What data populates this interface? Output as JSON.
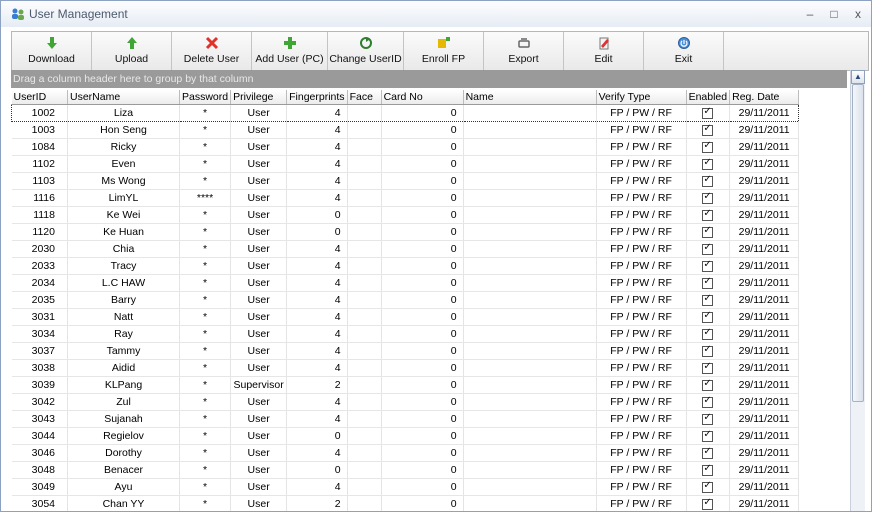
{
  "window": {
    "title": "User Management",
    "minimize": "–",
    "maximize": "□",
    "close": "x"
  },
  "toolbar": [
    {
      "label": "Download",
      "icon": "download-icon"
    },
    {
      "label": "Upload",
      "icon": "upload-icon"
    },
    {
      "label": "Delete User",
      "icon": "delete-user-icon"
    },
    {
      "label": "Add User (PC)",
      "icon": "add-user-icon"
    },
    {
      "label": "Change UserID",
      "icon": "change-userid-icon"
    },
    {
      "label": "Enroll FP",
      "icon": "enroll-fp-icon"
    },
    {
      "label": "Export",
      "icon": "export-icon"
    },
    {
      "label": "Edit",
      "icon": "edit-icon"
    },
    {
      "label": "Exit",
      "icon": "exit-icon"
    }
  ],
  "group_panel": "Drag a column header here to group by that column",
  "columns": [
    "UserID",
    "UserName",
    "Password",
    "Privilege",
    "Fingerprints",
    "Face",
    "Card No",
    "Name",
    "Verify Type",
    "Enabled",
    "Reg. Date"
  ],
  "rows": [
    {
      "id": "1002",
      "name": "Liza",
      "pw": "*",
      "priv": "User",
      "fp": "4",
      "face": "",
      "card": "0",
      "fullname": "",
      "verify": "FP / PW / RF",
      "enabled": true,
      "date": "29/11/2011"
    },
    {
      "id": "1003",
      "name": "Hon Seng",
      "pw": "*",
      "priv": "User",
      "fp": "4",
      "face": "",
      "card": "0",
      "fullname": "",
      "verify": "FP / PW / RF",
      "enabled": true,
      "date": "29/11/2011"
    },
    {
      "id": "1084",
      "name": "Ricky",
      "pw": "*",
      "priv": "User",
      "fp": "4",
      "face": "",
      "card": "0",
      "fullname": "",
      "verify": "FP / PW / RF",
      "enabled": true,
      "date": "29/11/2011"
    },
    {
      "id": "1102",
      "name": "Even",
      "pw": "*",
      "priv": "User",
      "fp": "4",
      "face": "",
      "card": "0",
      "fullname": "",
      "verify": "FP / PW / RF",
      "enabled": true,
      "date": "29/11/2011"
    },
    {
      "id": "1103",
      "name": "Ms Wong",
      "pw": "*",
      "priv": "User",
      "fp": "4",
      "face": "",
      "card": "0",
      "fullname": "",
      "verify": "FP / PW / RF",
      "enabled": true,
      "date": "29/11/2011"
    },
    {
      "id": "1116",
      "name": "LimYL",
      "pw": "****",
      "priv": "User",
      "fp": "4",
      "face": "",
      "card": "0",
      "fullname": "",
      "verify": "FP / PW / RF",
      "enabled": true,
      "date": "29/11/2011"
    },
    {
      "id": "1118",
      "name": "Ke Wei",
      "pw": "*",
      "priv": "User",
      "fp": "0",
      "face": "",
      "card": "0",
      "fullname": "",
      "verify": "FP / PW / RF",
      "enabled": true,
      "date": "29/11/2011"
    },
    {
      "id": "1120",
      "name": "Ke Huan",
      "pw": "*",
      "priv": "User",
      "fp": "0",
      "face": "",
      "card": "0",
      "fullname": "",
      "verify": "FP / PW / RF",
      "enabled": true,
      "date": "29/11/2011"
    },
    {
      "id": "2030",
      "name": "Chia",
      "pw": "*",
      "priv": "User",
      "fp": "4",
      "face": "",
      "card": "0",
      "fullname": "",
      "verify": "FP / PW / RF",
      "enabled": true,
      "date": "29/11/2011"
    },
    {
      "id": "2033",
      "name": "Tracy",
      "pw": "*",
      "priv": "User",
      "fp": "4",
      "face": "",
      "card": "0",
      "fullname": "",
      "verify": "FP / PW / RF",
      "enabled": true,
      "date": "29/11/2011"
    },
    {
      "id": "2034",
      "name": "L.C HAW",
      "pw": "*",
      "priv": "User",
      "fp": "4",
      "face": "",
      "card": "0",
      "fullname": "",
      "verify": "FP / PW / RF",
      "enabled": true,
      "date": "29/11/2011"
    },
    {
      "id": "2035",
      "name": "Barry",
      "pw": "*",
      "priv": "User",
      "fp": "4",
      "face": "",
      "card": "0",
      "fullname": "",
      "verify": "FP / PW / RF",
      "enabled": true,
      "date": "29/11/2011"
    },
    {
      "id": "3031",
      "name": "Natt",
      "pw": "*",
      "priv": "User",
      "fp": "4",
      "face": "",
      "card": "0",
      "fullname": "",
      "verify": "FP / PW / RF",
      "enabled": true,
      "date": "29/11/2011"
    },
    {
      "id": "3034",
      "name": "Ray",
      "pw": "*",
      "priv": "User",
      "fp": "4",
      "face": "",
      "card": "0",
      "fullname": "",
      "verify": "FP / PW / RF",
      "enabled": true,
      "date": "29/11/2011"
    },
    {
      "id": "3037",
      "name": "Tammy",
      "pw": "*",
      "priv": "User",
      "fp": "4",
      "face": "",
      "card": "0",
      "fullname": "",
      "verify": "FP / PW / RF",
      "enabled": true,
      "date": "29/11/2011"
    },
    {
      "id": "3038",
      "name": "Aidid",
      "pw": "*",
      "priv": "User",
      "fp": "4",
      "face": "",
      "card": "0",
      "fullname": "",
      "verify": "FP / PW / RF",
      "enabled": true,
      "date": "29/11/2011"
    },
    {
      "id": "3039",
      "name": "KLPang",
      "pw": "*",
      "priv": "Supervisor",
      "fp": "2",
      "face": "",
      "card": "0",
      "fullname": "",
      "verify": "FP / PW / RF",
      "enabled": true,
      "date": "29/11/2011"
    },
    {
      "id": "3042",
      "name": "Zul",
      "pw": "*",
      "priv": "User",
      "fp": "4",
      "face": "",
      "card": "0",
      "fullname": "",
      "verify": "FP / PW / RF",
      "enabled": true,
      "date": "29/11/2011"
    },
    {
      "id": "3043",
      "name": "Sujanah",
      "pw": "*",
      "priv": "User",
      "fp": "4",
      "face": "",
      "card": "0",
      "fullname": "",
      "verify": "FP / PW / RF",
      "enabled": true,
      "date": "29/11/2011"
    },
    {
      "id": "3044",
      "name": "Regielov",
      "pw": "*",
      "priv": "User",
      "fp": "0",
      "face": "",
      "card": "0",
      "fullname": "",
      "verify": "FP / PW / RF",
      "enabled": true,
      "date": "29/11/2011"
    },
    {
      "id": "3046",
      "name": "Dorothy",
      "pw": "*",
      "priv": "User",
      "fp": "4",
      "face": "",
      "card": "0",
      "fullname": "",
      "verify": "FP / PW / RF",
      "enabled": true,
      "date": "29/11/2011"
    },
    {
      "id": "3048",
      "name": "Benacer",
      "pw": "*",
      "priv": "User",
      "fp": "0",
      "face": "",
      "card": "0",
      "fullname": "",
      "verify": "FP / PW / RF",
      "enabled": true,
      "date": "29/11/2011"
    },
    {
      "id": "3049",
      "name": "Ayu",
      "pw": "*",
      "priv": "User",
      "fp": "4",
      "face": "",
      "card": "0",
      "fullname": "",
      "verify": "FP / PW / RF",
      "enabled": true,
      "date": "29/11/2011"
    },
    {
      "id": "3054",
      "name": "Chan YY",
      "pw": "*",
      "priv": "User",
      "fp": "2",
      "face": "",
      "card": "0",
      "fullname": "",
      "verify": "FP / PW / RF",
      "enabled": true,
      "date": "29/11/2011"
    }
  ],
  "colors": {
    "accent": "#2c6fb5",
    "group_panel": "#9a9a9a",
    "window_border": "#8da2c2"
  }
}
